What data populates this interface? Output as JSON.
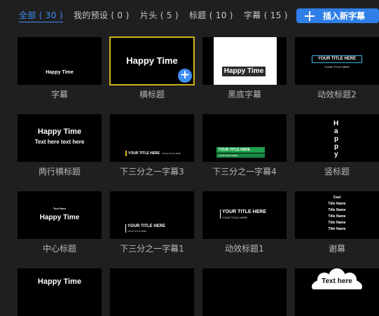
{
  "tabs": [
    {
      "label": "全部 ( 30 )"
    },
    {
      "label": "我的预设 ( 0 )"
    },
    {
      "label": "片头 ( 5 )"
    },
    {
      "label": "标题 ( 10 )"
    },
    {
      "label": "字幕 ( 15 )"
    }
  ],
  "insert_button": "插入新字幕",
  "cards": [
    {
      "label": "字幕",
      "thumb": [
        "Happy Time"
      ]
    },
    {
      "label": "横标题",
      "thumb": [
        "Happy Time"
      ]
    },
    {
      "label": "黑底字幕",
      "thumb": [
        "Happy Time"
      ]
    },
    {
      "label": "动效标题2",
      "thumb": [
        "YOUR TITLE HERE",
        "YOUR TITLE HERE"
      ]
    },
    {
      "label": "两行横标题",
      "thumb": [
        "Happy Time",
        "Text here text here"
      ]
    },
    {
      "label": "下三分之一字幕3",
      "thumb": [
        "YOUR TITLE HERE",
        "YOUR TITLE HERE"
      ]
    },
    {
      "label": "下三分之一字幕4",
      "thumb": [
        "YOUR TITLE HERE",
        "YOUR TITLE HERE"
      ]
    },
    {
      "label": "竖标题",
      "thumb": [
        "H",
        "a",
        "p",
        "p",
        "y"
      ]
    },
    {
      "label": "中心标题",
      "thumb": [
        "Text Here",
        "Happy Time"
      ]
    },
    {
      "label": "下三分之一字幕1",
      "thumb": [
        "YOUR TITLE HERE",
        "YOUR TITLE HERE"
      ]
    },
    {
      "label": "动效标题1",
      "thumb": [
        "YOUR TITLE HERE",
        "YOUR TITLE HERE"
      ]
    },
    {
      "label": "谢幕",
      "thumb": [
        "Cast",
        "Title Name",
        "Title Name",
        "Title Name",
        "Title Name",
        "Title Name"
      ]
    },
    {
      "label": "",
      "thumb": [
        "Happy Time"
      ]
    },
    {
      "label": "",
      "thumb": []
    },
    {
      "label": "",
      "thumb": []
    },
    {
      "label": "",
      "thumb": [
        "Text here"
      ]
    }
  ]
}
